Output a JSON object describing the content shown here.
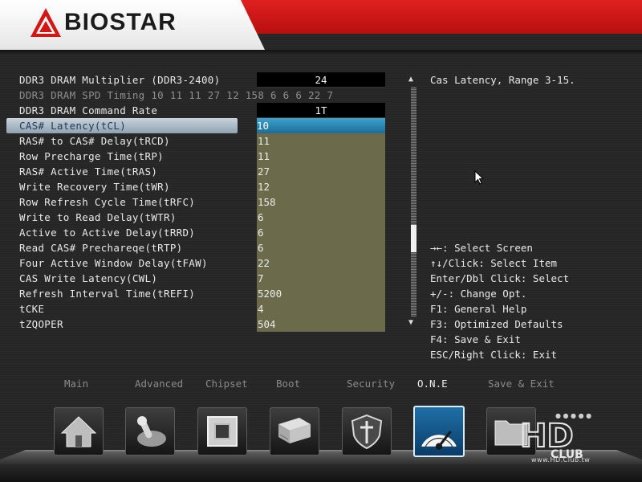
{
  "header": {
    "brand": "BIOSTAR",
    "colors": {
      "red": "#d41616",
      "white": "#ffffff"
    }
  },
  "settings": [
    {
      "label": "DDR3 DRAM Multiplier  (DDR3-2400)",
      "value": "24",
      "style": "box"
    },
    {
      "label": "DDR3 DRAM SPD Timing 10 11 11 27 12 158 6 6 6 22 7",
      "value": "",
      "style": "none",
      "disabled": true
    },
    {
      "label": "DDR3 DRAM Command Rate",
      "value": "1T",
      "style": "box"
    },
    {
      "label": "CAS# Latency(tCL)",
      "value": "10",
      "style": "hl",
      "selected": true
    },
    {
      "label": "RAS# to CAS# Delay(tRCD)",
      "value": "11",
      "style": "opt"
    },
    {
      "label": "Row Precharge Time(tRP)",
      "value": "11",
      "style": "opt"
    },
    {
      "label": "RAS# Active Time(tRAS)",
      "value": "27",
      "style": "opt"
    },
    {
      "label": "Write Recovery Time(tWR)",
      "value": "12",
      "style": "opt"
    },
    {
      "label": "Row Refresh Cycle Time(tRFC)",
      "value": "158",
      "style": "opt"
    },
    {
      "label": "Write to Read Delay(tWTR)",
      "value": "6",
      "style": "opt"
    },
    {
      "label": "Active to Active Delay(tRRD)",
      "value": "6",
      "style": "opt"
    },
    {
      "label": "Read CAS# Prechareqe(tRTP)",
      "value": "6",
      "style": "opt"
    },
    {
      "label": "Four Active Window Delay(tFAW)",
      "value": "22",
      "style": "opt"
    },
    {
      "label": "CAS Write Latency(CWL)",
      "value": "7",
      "style": "opt"
    },
    {
      "label": "Refresh Interval Time(tREFI)",
      "value": "5200",
      "style": "opt"
    },
    {
      "label": "tCKE",
      "value": "4",
      "style": "opt"
    },
    {
      "label": "tZQOPER",
      "value": "504",
      "style": "opt"
    }
  ],
  "scrollbar": {
    "up_arrow": "▲",
    "down_arrow": "▼"
  },
  "help": {
    "text": "Cas Latency, Range 3-15.",
    "keys": [
      "→←: Select Screen",
      "↑↓/Click: Select Item",
      "Enter/Dbl Click: Select",
      "+/-: Change Opt.",
      "F1: General Help",
      "F3: Optimized Defaults",
      "F4: Save & Exit",
      "ESC/Right Click: Exit"
    ]
  },
  "tabs": [
    {
      "label": "Main",
      "icon": "home-icon"
    },
    {
      "label": "Advanced",
      "icon": "joystick-icon"
    },
    {
      "label": "Chipset",
      "icon": "chip-icon"
    },
    {
      "label": "Boot",
      "icon": "drive-icon"
    },
    {
      "label": "Security",
      "icon": "shield-icon"
    },
    {
      "label": "O.N.E",
      "icon": "speedometer-icon",
      "active": true
    },
    {
      "label": "Save & Exit",
      "icon": "folder-icon"
    }
  ],
  "watermark": {
    "site": "www.HD.Club.tw",
    "brand": "HD CLUB"
  }
}
